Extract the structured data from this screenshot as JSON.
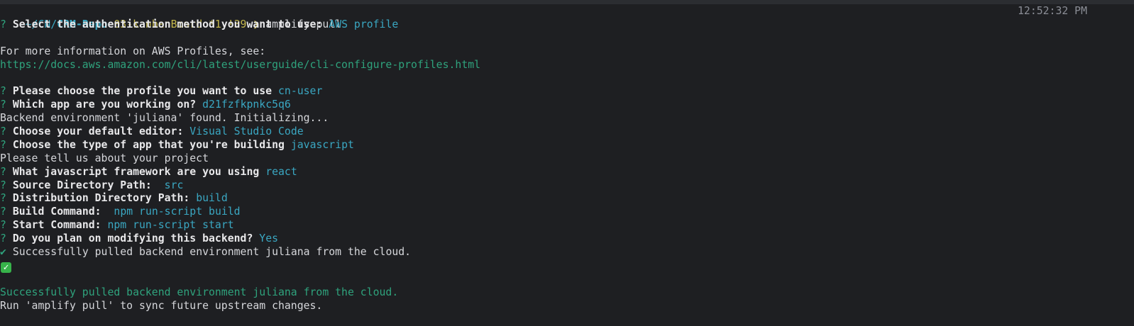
{
  "prompt": {
    "path": "~/CN/",
    "repo": "CRM-Repo",
    "git_status": "03-kanbanBoard *1 !39",
    "arrow": "❯",
    "command": "amplify pull",
    "time": "12:52:32 PM"
  },
  "lines": {
    "auth": {
      "q": "?",
      "label": "Select the authentication method you want to use:",
      "value": "AWS profile"
    },
    "info": "For more information on AWS Profiles, see:",
    "url": "https://docs.aws.amazon.com/cli/latest/userguide/cli-configure-profiles.html",
    "profile": {
      "q": "?",
      "label": "Please choose the profile you want to use",
      "value": "cn-user"
    },
    "app": {
      "q": "?",
      "label": "Which app are you working on?",
      "value": "d21fzfkpnkc5q6"
    },
    "backend_found": "Backend environment 'juliana' found. Initializing...",
    "editor": {
      "q": "?",
      "label": "Choose your default editor:",
      "value": "Visual Studio Code"
    },
    "app_type": {
      "q": "?",
      "label": "Choose the type of app that you're building",
      "value": "javascript"
    },
    "tell_us": "Please tell us about your project",
    "framework": {
      "q": "?",
      "label": "What javascript framework are you using",
      "value": "react"
    },
    "source_dir": {
      "q": "?",
      "label": "Source Directory Path: ",
      "value": "src"
    },
    "dist_dir": {
      "q": "?",
      "label": "Distribution Directory Path:",
      "value": "build"
    },
    "build_cmd": {
      "q": "?",
      "label": "Build Command: ",
      "value": "npm run-script build"
    },
    "start_cmd": {
      "q": "?",
      "label": "Start Command:",
      "value": "npm run-script start"
    },
    "modify": {
      "q": "?",
      "label": "Do you plan on modifying this backend?",
      "value": "Yes"
    },
    "success_check": {
      "mark": "✔",
      "text": "Successfully pulled backend environment juliana from the cloud."
    },
    "emoji": "✓",
    "success_green": "Successfully pulled backend environment juliana from the cloud.",
    "run_hint": "Run 'amplify pull' to sync future upstream changes."
  }
}
